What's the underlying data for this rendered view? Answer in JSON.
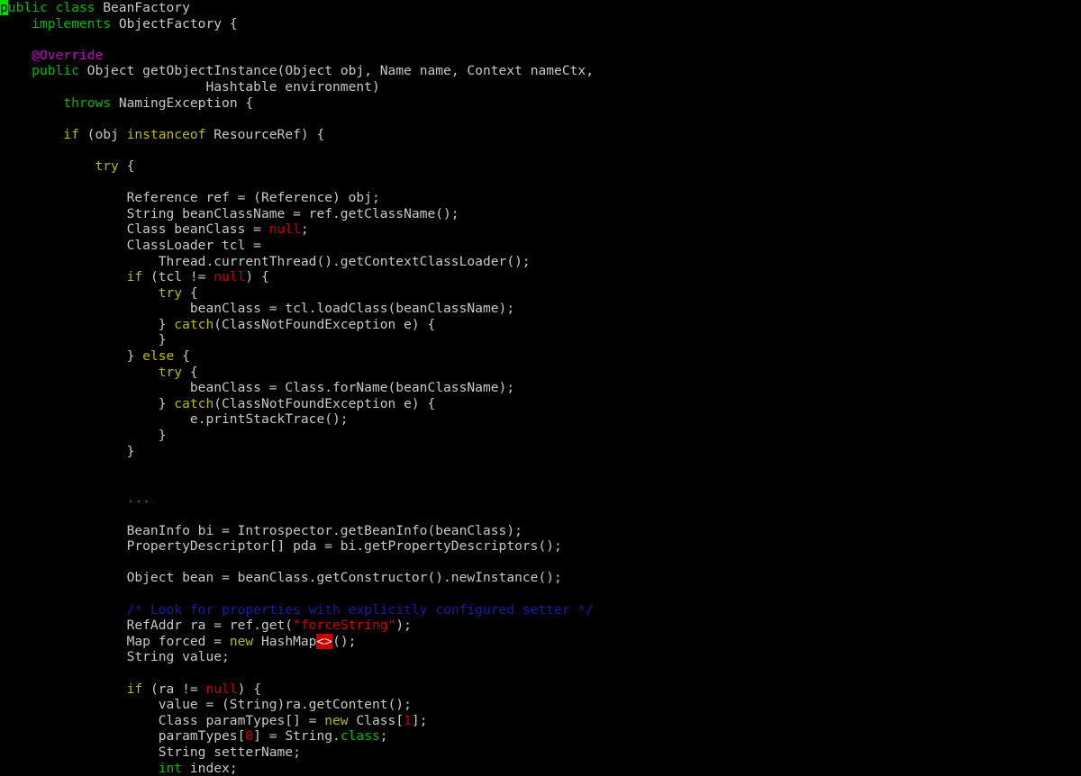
{
  "window": {
    "background_color": "#000000",
    "default_text_color": "#c8c8c8",
    "font_size_px": 14.6,
    "line_height_px": 17.6
  },
  "palette": {
    "keyword": "#00bb00",
    "control": "#bbbb00",
    "annotation": "#cc00cc",
    "constant": "#cc0000",
    "string": "#cc0000",
    "comment": "#1a1aaa",
    "plain": "#c8c8c8",
    "special": "#008b8b",
    "cursor_bg": "#00dd00",
    "cursor_fg": "#000000",
    "error_bg": "#cc0000",
    "error_fg": "#e8e8e8"
  },
  "cursor": {
    "char": "p",
    "line": 0,
    "column": 0
  },
  "code": {
    "language": "java",
    "class_name": "BeanFactory",
    "lines": [
      {
        "n": 0,
        "segs": [
          {
            "t": "p",
            "c": "cursor"
          },
          {
            "t": "ublic ",
            "c": "keyword"
          },
          {
            "t": "class ",
            "c": "keyword"
          },
          {
            "t": "BeanFactory",
            "c": "plain"
          }
        ]
      },
      {
        "n": 1,
        "segs": [
          {
            "t": "    ",
            "c": "plain"
          },
          {
            "t": "implements ",
            "c": "keyword"
          },
          {
            "t": "ObjectFactory {",
            "c": "plain"
          }
        ]
      },
      {
        "n": 2,
        "segs": [
          {
            "t": "",
            "c": "plain"
          }
        ]
      },
      {
        "n": 3,
        "segs": [
          {
            "t": "    ",
            "c": "plain"
          },
          {
            "t": "@Override",
            "c": "annotation"
          }
        ]
      },
      {
        "n": 4,
        "segs": [
          {
            "t": "    ",
            "c": "plain"
          },
          {
            "t": "public ",
            "c": "keyword"
          },
          {
            "t": "Object getObjectInstance(Object obj, Name name, Context nameCtx,",
            "c": "plain"
          }
        ]
      },
      {
        "n": 5,
        "segs": [
          {
            "t": "                          Hashtable environment)",
            "c": "plain"
          }
        ]
      },
      {
        "n": 6,
        "segs": [
          {
            "t": "        ",
            "c": "plain"
          },
          {
            "t": "throws ",
            "c": "keyword"
          },
          {
            "t": "NamingException {",
            "c": "plain"
          }
        ]
      },
      {
        "n": 7,
        "segs": [
          {
            "t": "",
            "c": "plain"
          }
        ]
      },
      {
        "n": 8,
        "segs": [
          {
            "t": "        ",
            "c": "plain"
          },
          {
            "t": "if ",
            "c": "control"
          },
          {
            "t": "(obj ",
            "c": "plain"
          },
          {
            "t": "instanceof ",
            "c": "control"
          },
          {
            "t": "ResourceRef) {",
            "c": "plain"
          }
        ]
      },
      {
        "n": 9,
        "segs": [
          {
            "t": "",
            "c": "plain"
          }
        ]
      },
      {
        "n": 10,
        "segs": [
          {
            "t": "            ",
            "c": "plain"
          },
          {
            "t": "try",
            "c": "control"
          },
          {
            "t": " {",
            "c": "plain"
          }
        ]
      },
      {
        "n": 11,
        "segs": [
          {
            "t": "",
            "c": "plain"
          }
        ]
      },
      {
        "n": 12,
        "segs": [
          {
            "t": "                Reference ref = (Reference) obj;",
            "c": "plain"
          }
        ]
      },
      {
        "n": 13,
        "segs": [
          {
            "t": "                String beanClassName = ref.getClassName();",
            "c": "plain"
          }
        ]
      },
      {
        "n": 14,
        "segs": [
          {
            "t": "                Class beanClass = ",
            "c": "plain"
          },
          {
            "t": "null",
            "c": "constant"
          },
          {
            "t": ";",
            "c": "plain"
          }
        ]
      },
      {
        "n": 15,
        "segs": [
          {
            "t": "                ClassLoader tcl =",
            "c": "plain"
          }
        ]
      },
      {
        "n": 16,
        "segs": [
          {
            "t": "                    Thread.currentThread().getContextClassLoader();",
            "c": "plain"
          }
        ]
      },
      {
        "n": 17,
        "segs": [
          {
            "t": "                ",
            "c": "plain"
          },
          {
            "t": "if ",
            "c": "control"
          },
          {
            "t": "(tcl != ",
            "c": "plain"
          },
          {
            "t": "null",
            "c": "constant"
          },
          {
            "t": ") {",
            "c": "plain"
          }
        ]
      },
      {
        "n": 18,
        "segs": [
          {
            "t": "                    ",
            "c": "plain"
          },
          {
            "t": "try",
            "c": "control"
          },
          {
            "t": " {",
            "c": "plain"
          }
        ]
      },
      {
        "n": 19,
        "segs": [
          {
            "t": "                        beanClass = tcl.loadClass(beanClassName);",
            "c": "plain"
          }
        ]
      },
      {
        "n": 20,
        "segs": [
          {
            "t": "                    } ",
            "c": "plain"
          },
          {
            "t": "catch",
            "c": "control"
          },
          {
            "t": "(ClassNotFoundException e) {",
            "c": "plain"
          }
        ]
      },
      {
        "n": 21,
        "segs": [
          {
            "t": "                    }",
            "c": "plain"
          }
        ]
      },
      {
        "n": 22,
        "segs": [
          {
            "t": "                } ",
            "c": "plain"
          },
          {
            "t": "else",
            "c": "control"
          },
          {
            "t": " {",
            "c": "plain"
          }
        ]
      },
      {
        "n": 23,
        "segs": [
          {
            "t": "                    ",
            "c": "plain"
          },
          {
            "t": "try",
            "c": "control"
          },
          {
            "t": " {",
            "c": "plain"
          }
        ]
      },
      {
        "n": 24,
        "segs": [
          {
            "t": "                        beanClass = Class.forName(beanClassName);",
            "c": "plain"
          }
        ]
      },
      {
        "n": 25,
        "segs": [
          {
            "t": "                    } ",
            "c": "plain"
          },
          {
            "t": "catch",
            "c": "control"
          },
          {
            "t": "(ClassNotFoundException e) {",
            "c": "plain"
          }
        ]
      },
      {
        "n": 26,
        "segs": [
          {
            "t": "                        e.printStackTrace();",
            "c": "plain"
          }
        ]
      },
      {
        "n": 27,
        "segs": [
          {
            "t": "                    }",
            "c": "plain"
          }
        ]
      },
      {
        "n": 28,
        "segs": [
          {
            "t": "                }",
            "c": "plain"
          }
        ]
      },
      {
        "n": 29,
        "segs": [
          {
            "t": "",
            "c": "plain"
          }
        ]
      },
      {
        "n": 30,
        "segs": [
          {
            "t": "",
            "c": "plain"
          }
        ]
      },
      {
        "n": 31,
        "segs": [
          {
            "t": "                ",
            "c": "plain"
          },
          {
            "t": "...",
            "c": "special"
          }
        ]
      },
      {
        "n": 32,
        "segs": [
          {
            "t": "",
            "c": "plain"
          }
        ]
      },
      {
        "n": 33,
        "segs": [
          {
            "t": "                BeanInfo bi = Introspector.getBeanInfo(beanClass);",
            "c": "plain"
          }
        ]
      },
      {
        "n": 34,
        "segs": [
          {
            "t": "                PropertyDescriptor[] pda = bi.getPropertyDescriptors();",
            "c": "plain"
          }
        ]
      },
      {
        "n": 35,
        "segs": [
          {
            "t": "",
            "c": "plain"
          }
        ]
      },
      {
        "n": 36,
        "segs": [
          {
            "t": "                Object bean = beanClass.getConstructor().newInstance();",
            "c": "plain"
          }
        ]
      },
      {
        "n": 37,
        "segs": [
          {
            "t": "",
            "c": "plain"
          }
        ]
      },
      {
        "n": 38,
        "segs": [
          {
            "t": "                ",
            "c": "plain"
          },
          {
            "t": "/* Look for properties with explicitly configured setter */",
            "c": "comment"
          }
        ]
      },
      {
        "n": 39,
        "segs": [
          {
            "t": "                RefAddr ra = ref.get(",
            "c": "plain"
          },
          {
            "t": "\"forceString\"",
            "c": "string"
          },
          {
            "t": ");",
            "c": "plain"
          }
        ]
      },
      {
        "n": 40,
        "segs": [
          {
            "t": "                Map forced = ",
            "c": "plain"
          },
          {
            "t": "new ",
            "c": "control"
          },
          {
            "t": "HashMap",
            "c": "plain"
          },
          {
            "t": "<>",
            "c": "error"
          },
          {
            "t": "();",
            "c": "plain"
          }
        ]
      },
      {
        "n": 41,
        "segs": [
          {
            "t": "                String value;",
            "c": "plain"
          }
        ]
      },
      {
        "n": 42,
        "segs": [
          {
            "t": "",
            "c": "plain"
          }
        ]
      },
      {
        "n": 43,
        "segs": [
          {
            "t": "                ",
            "c": "plain"
          },
          {
            "t": "if ",
            "c": "control"
          },
          {
            "t": "(ra != ",
            "c": "plain"
          },
          {
            "t": "null",
            "c": "constant"
          },
          {
            "t": ") {",
            "c": "plain"
          }
        ]
      },
      {
        "n": 44,
        "segs": [
          {
            "t": "                    value = (String)ra.getContent();",
            "c": "plain"
          }
        ]
      },
      {
        "n": 45,
        "segs": [
          {
            "t": "                    Class paramTypes[] = ",
            "c": "plain"
          },
          {
            "t": "new ",
            "c": "control"
          },
          {
            "t": "Class[",
            "c": "plain"
          },
          {
            "t": "1",
            "c": "constant"
          },
          {
            "t": "];",
            "c": "plain"
          }
        ]
      },
      {
        "n": 46,
        "segs": [
          {
            "t": "                    paramTypes[",
            "c": "plain"
          },
          {
            "t": "0",
            "c": "constant"
          },
          {
            "t": "] = String.",
            "c": "plain"
          },
          {
            "t": "class",
            "c": "keyword"
          },
          {
            "t": ";",
            "c": "plain"
          }
        ]
      },
      {
        "n": 47,
        "segs": [
          {
            "t": "                    String setterName;",
            "c": "plain"
          }
        ]
      },
      {
        "n": 48,
        "segs": [
          {
            "t": "                    ",
            "c": "plain"
          },
          {
            "t": "int ",
            "c": "keyword"
          },
          {
            "t": "index;",
            "c": "plain"
          }
        ]
      }
    ]
  }
}
